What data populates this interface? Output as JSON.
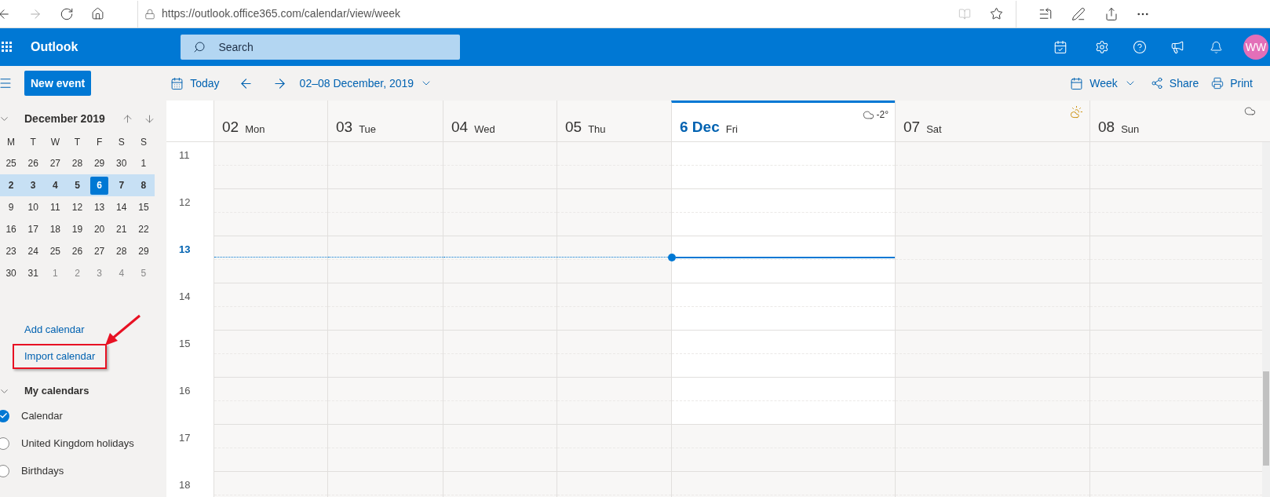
{
  "browser": {
    "url": "https://outlook.office365.com/calendar/view/week"
  },
  "app_bar": {
    "title": "Outlook",
    "search_placeholder": "Search",
    "avatar": "WW"
  },
  "toolbar": {
    "new_event": "New event",
    "today": "Today",
    "range": "02–08 December, 2019",
    "view": "Week",
    "share": "Share",
    "print": "Print"
  },
  "mini_calendar": {
    "title": "December 2019",
    "weekdays": [
      "M",
      "T",
      "W",
      "T",
      "F",
      "S",
      "S"
    ],
    "weeks": [
      {
        "in_view": false,
        "days": [
          {
            "day": "25",
            "muted": false,
            "selected": false
          },
          {
            "day": "26",
            "muted": false,
            "selected": false
          },
          {
            "day": "27",
            "muted": false,
            "selected": false
          },
          {
            "day": "28",
            "muted": false,
            "selected": false
          },
          {
            "day": "29",
            "muted": false,
            "selected": false
          },
          {
            "day": "30",
            "muted": false,
            "selected": false
          },
          {
            "day": "1",
            "muted": false,
            "selected": false
          }
        ]
      },
      {
        "in_view": true,
        "days": [
          {
            "day": "2",
            "muted": false,
            "selected": false
          },
          {
            "day": "3",
            "muted": false,
            "selected": false
          },
          {
            "day": "4",
            "muted": false,
            "selected": false
          },
          {
            "day": "5",
            "muted": false,
            "selected": false
          },
          {
            "day": "6",
            "muted": false,
            "selected": true
          },
          {
            "day": "7",
            "muted": false,
            "selected": false
          },
          {
            "day": "8",
            "muted": false,
            "selected": false
          }
        ]
      },
      {
        "in_view": false,
        "days": [
          {
            "day": "9",
            "muted": false,
            "selected": false
          },
          {
            "day": "10",
            "muted": false,
            "selected": false
          },
          {
            "day": "11",
            "muted": false,
            "selected": false
          },
          {
            "day": "12",
            "muted": false,
            "selected": false
          },
          {
            "day": "13",
            "muted": false,
            "selected": false
          },
          {
            "day": "14",
            "muted": false,
            "selected": false
          },
          {
            "day": "15",
            "muted": false,
            "selected": false
          }
        ]
      },
      {
        "in_view": false,
        "days": [
          {
            "day": "16",
            "muted": false,
            "selected": false
          },
          {
            "day": "17",
            "muted": false,
            "selected": false
          },
          {
            "day": "18",
            "muted": false,
            "selected": false
          },
          {
            "day": "19",
            "muted": false,
            "selected": false
          },
          {
            "day": "20",
            "muted": false,
            "selected": false
          },
          {
            "day": "21",
            "muted": false,
            "selected": false
          },
          {
            "day": "22",
            "muted": false,
            "selected": false
          }
        ]
      },
      {
        "in_view": false,
        "days": [
          {
            "day": "23",
            "muted": false,
            "selected": false
          },
          {
            "day": "24",
            "muted": false,
            "selected": false
          },
          {
            "day": "25",
            "muted": false,
            "selected": false
          },
          {
            "day": "26",
            "muted": false,
            "selected": false
          },
          {
            "day": "27",
            "muted": false,
            "selected": false
          },
          {
            "day": "28",
            "muted": false,
            "selected": false
          },
          {
            "day": "29",
            "muted": false,
            "selected": false
          }
        ]
      },
      {
        "in_view": false,
        "days": [
          {
            "day": "30",
            "muted": false,
            "selected": false
          },
          {
            "day": "31",
            "muted": false,
            "selected": false
          },
          {
            "day": "1",
            "muted": true,
            "selected": false
          },
          {
            "day": "2",
            "muted": true,
            "selected": false
          },
          {
            "day": "3",
            "muted": true,
            "selected": false
          },
          {
            "day": "4",
            "muted": true,
            "selected": false
          },
          {
            "day": "5",
            "muted": true,
            "selected": false
          }
        ]
      }
    ]
  },
  "links": [
    {
      "label": "Add calendar",
      "annotated": false
    },
    {
      "label": "Import calendar",
      "annotated": true
    }
  ],
  "my_calendars": {
    "title": "My calendars",
    "items": [
      {
        "label": "Calendar",
        "checked": true
      },
      {
        "label": "United Kingdom holidays",
        "checked": false
      },
      {
        "label": "Birthdays",
        "checked": false
      }
    ]
  },
  "days": [
    {
      "date": "02",
      "weekday": "Mon",
      "today": false
    },
    {
      "date": "03",
      "weekday": "Tue",
      "today": false
    },
    {
      "date": "04",
      "weekday": "Wed",
      "today": false
    },
    {
      "date": "05",
      "weekday": "Thu",
      "today": false
    },
    {
      "date": "6 Dec",
      "weekday": "Fri",
      "today": true,
      "weather": {
        "kind": "cloud"
      },
      "temperature": "-2°"
    },
    {
      "date": "07",
      "weekday": "Sat",
      "today": false,
      "weather": {
        "kind": "partly_sunny"
      }
    },
    {
      "date": "08",
      "weekday": "Sun",
      "today": false,
      "weather": {
        "kind": "cloud"
      }
    }
  ],
  "hours": [
    {
      "label": "11",
      "current": false
    },
    {
      "label": "12",
      "current": false
    },
    {
      "label": "13",
      "current": true
    },
    {
      "label": "14",
      "current": false
    },
    {
      "label": "15",
      "current": false
    },
    {
      "label": "16",
      "current": false
    },
    {
      "label": "17",
      "current": false
    },
    {
      "label": "18",
      "current": false
    }
  ]
}
